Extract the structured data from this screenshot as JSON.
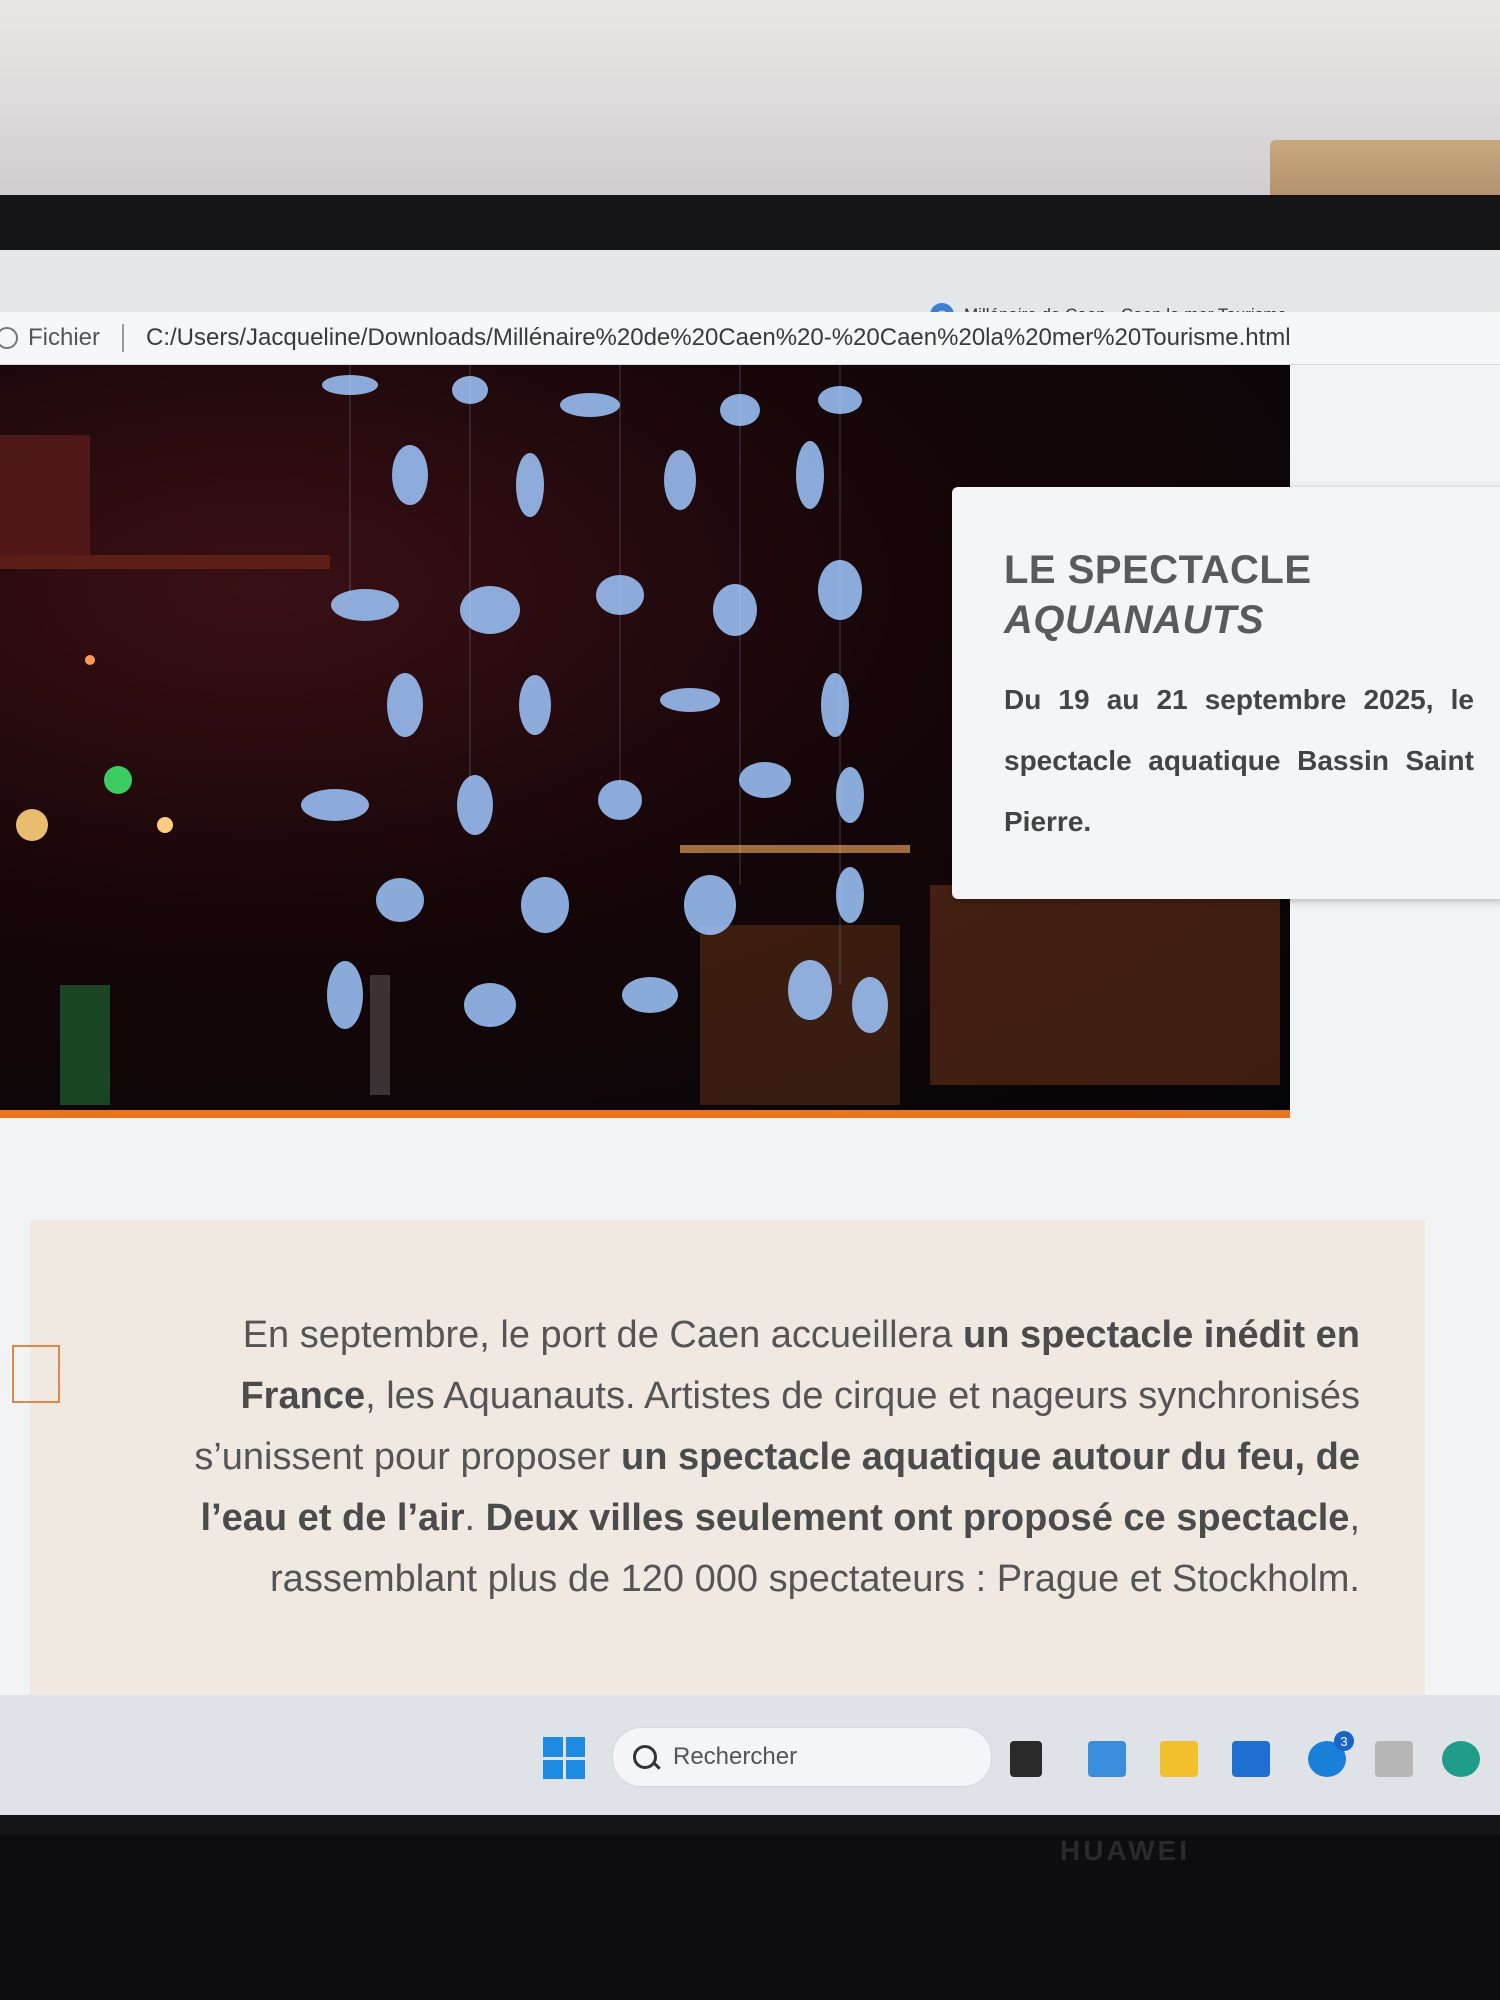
{
  "browser": {
    "tab_title": "Millénaire de Caen - Caen la mer Tourisme",
    "tab_icon_glyph": "◉",
    "address_label": "Fichier",
    "address_url": "C:/Users/Jacqueline/Downloads/Millénaire%20de%20Caen%20-%20Caen%20la%20mer%20Tourisme.html"
  },
  "info_card": {
    "title_line1": "LE SPECTACLE",
    "title_line2": "AQUANAUTS",
    "body": "Du 19 au 21 septembre 2025, le spectacle aquatique Bassin Saint Pierre."
  },
  "article": {
    "p1": "En septembre, le port de Caen accueillera ",
    "b1": "un spectacle inédit en France",
    "p2": ", les Aquanauts. Artistes de cirque et nageurs synchronisés s’unissent pour proposer ",
    "b2": "un spectacle aquatique autour du feu, de l’eau et de l’air",
    "p3": ". ",
    "b3": "Deux villes seulement ont proposé ce spectacle",
    "p4": ", rassemblant plus de 120 000 spectateurs : Prague et Stockholm."
  },
  "taskbar": {
    "search_placeholder": "Rechercher",
    "skype_badge": "3"
  },
  "monitor": {
    "brand": "HUAWEI"
  },
  "colors": {
    "accent_orange": "#e8741e",
    "fab_teal": "#2bb3c9",
    "windows_blue": "#1f8be0"
  }
}
